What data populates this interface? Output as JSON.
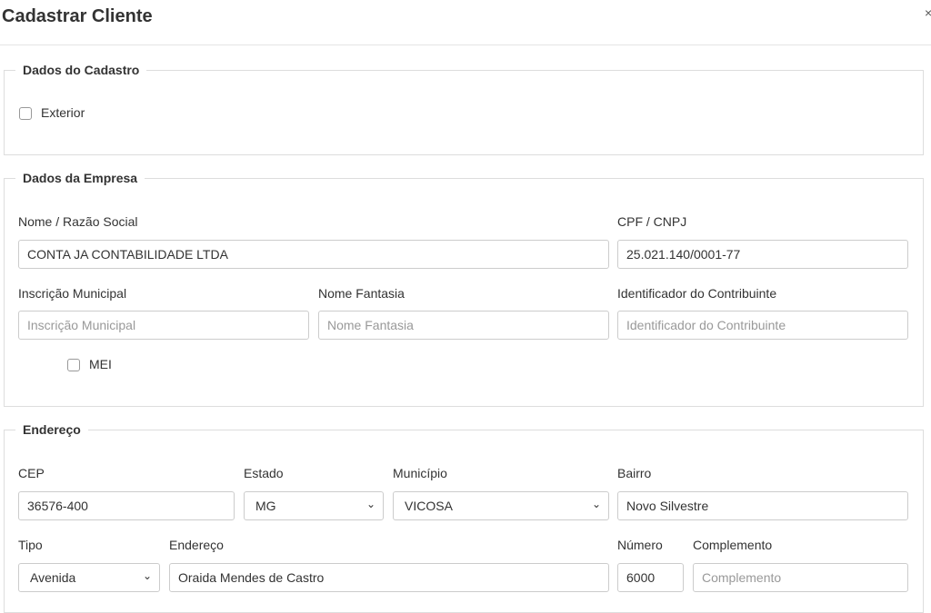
{
  "modal": {
    "title": "Cadastrar Cliente",
    "close_glyph": "×"
  },
  "cadastro": {
    "legend": "Dados do Cadastro",
    "exterior_label": "Exterior"
  },
  "empresa": {
    "legend": "Dados da Empresa",
    "nome_label": "Nome / Razão Social",
    "nome_value": "CONTA JA CONTABILIDADE LTDA",
    "cpf_label": "CPF / CNPJ",
    "cpf_value": "25.021.140/0001-77",
    "inscricao_label": "Inscrição Municipal",
    "inscricao_placeholder": "Inscrição Municipal",
    "fantasia_label": "Nome Fantasia",
    "fantasia_placeholder": "Nome Fantasia",
    "identificador_label": "Identificador do Contribuinte",
    "identificador_placeholder": "Identificador do Contribuinte",
    "mei_label": "MEI"
  },
  "endereco": {
    "legend": "Endereço",
    "cep_label": "CEP",
    "cep_value": "36576-400",
    "estado_label": "Estado",
    "estado_value": "MG",
    "municipio_label": "Município",
    "municipio_value": "VICOSA",
    "bairro_label": "Bairro",
    "bairro_value": "Novo Silvestre",
    "tipo_label": "Tipo",
    "tipo_value": "Avenida",
    "endereco_label": "Endereço",
    "endereco_value": "Oraida Mendes de Castro",
    "numero_label": "Número",
    "numero_value": "6000",
    "complemento_label": "Complemento",
    "complemento_placeholder": "Complemento"
  }
}
